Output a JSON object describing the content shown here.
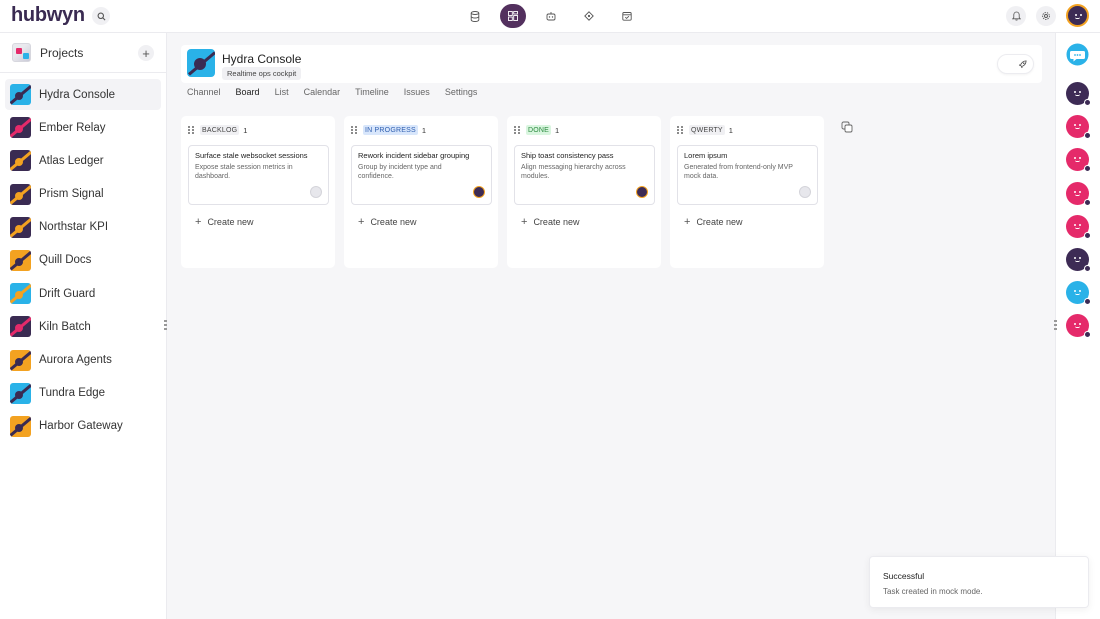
{
  "app": {
    "logo": "hubwyn"
  },
  "topbar": {
    "nav": [
      {
        "icon": "database-icon"
      },
      {
        "icon": "board-icon",
        "active": true
      },
      {
        "icon": "robot-icon"
      },
      {
        "icon": "network-icon"
      },
      {
        "icon": "calendar-check-icon"
      }
    ]
  },
  "sidebar": {
    "title": "Projects",
    "add_label": "+",
    "items": [
      {
        "label": "Hydra Console",
        "active": true,
        "bg": "#2ab2e8",
        "accent": "#3a2b52"
      },
      {
        "label": "Ember Relay",
        "bg": "#3a2b52",
        "accent": "#e52a6a"
      },
      {
        "label": "Atlas Ledger",
        "bg": "#3a2b52",
        "accent": "#f3a221"
      },
      {
        "label": "Prism Signal",
        "bg": "#3a2b52",
        "accent": "#f3a221"
      },
      {
        "label": "Northstar KPI",
        "bg": "#3a2b52",
        "accent": "#f3a221"
      },
      {
        "label": "Quill Docs",
        "bg": "#f3a221",
        "accent": "#3a2b52"
      },
      {
        "label": "Drift Guard",
        "bg": "#2ab2e8",
        "accent": "#f3a221"
      },
      {
        "label": "Kiln Batch",
        "bg": "#3a2b52",
        "accent": "#e52a6a"
      },
      {
        "label": "Aurora Agents",
        "bg": "#f3a221",
        "accent": "#3a2b52"
      },
      {
        "label": "Tundra Edge",
        "bg": "#2ab2e8",
        "accent": "#3a2b52"
      },
      {
        "label": "Harbor Gateway",
        "bg": "#f3a221",
        "accent": "#3a2b52"
      }
    ]
  },
  "project": {
    "title": "Hydra Console",
    "tag": "Realtime ops cockpit"
  },
  "tabs": [
    "Channel",
    "Board",
    "List",
    "Calendar",
    "Timeline",
    "Issues",
    "Settings"
  ],
  "active_tab": "Board",
  "board": {
    "create_label": "Create new",
    "columns": [
      {
        "label": "BACKLOG",
        "count": "1",
        "label_bg": "#f0f0f3",
        "label_color": "#444",
        "card": {
          "title": "Surface stale websocket sessions",
          "desc": "Expose stale session metrics in dashboard.",
          "avatar": "grey"
        }
      },
      {
        "label": "IN PROGRESS",
        "count": "1",
        "label_bg": "#d8e6fb",
        "label_color": "#2f5fb0",
        "card": {
          "title": "Rework incident sidebar grouping",
          "desc": "Group by incident type and confidence.",
          "avatar": "dark"
        }
      },
      {
        "label": "DONE",
        "count": "1",
        "label_bg": "#d9f5df",
        "label_color": "#2a8a3e",
        "card": {
          "title": "Ship toast consistency pass",
          "desc": "Align messaging hierarchy across modules.",
          "avatar": "dark"
        }
      },
      {
        "label": "QWERTY",
        "count": "1",
        "label_bg": "#f0f0f3",
        "label_color": "#444",
        "card": {
          "title": "Lorem ipsum",
          "desc": "Generated from frontend-only MVP mock data.",
          "avatar": "grey"
        }
      }
    ]
  },
  "rightbar": {
    "avatars": [
      {
        "color": "#3d2b55",
        "status": true
      },
      {
        "color": "#e52a6a",
        "status": true
      },
      {
        "color": "#e52a6a",
        "status": true
      },
      {
        "color": "#e52a6a",
        "status": true
      },
      {
        "color": "#e52a6a",
        "status": true
      },
      {
        "color": "#3d2b55",
        "status": true
      },
      {
        "color": "#2ab2e8",
        "status": true
      },
      {
        "color": "#e52a6a",
        "status": true
      }
    ]
  },
  "toast": {
    "title": "Successful",
    "message": "Task created in mock mode."
  }
}
